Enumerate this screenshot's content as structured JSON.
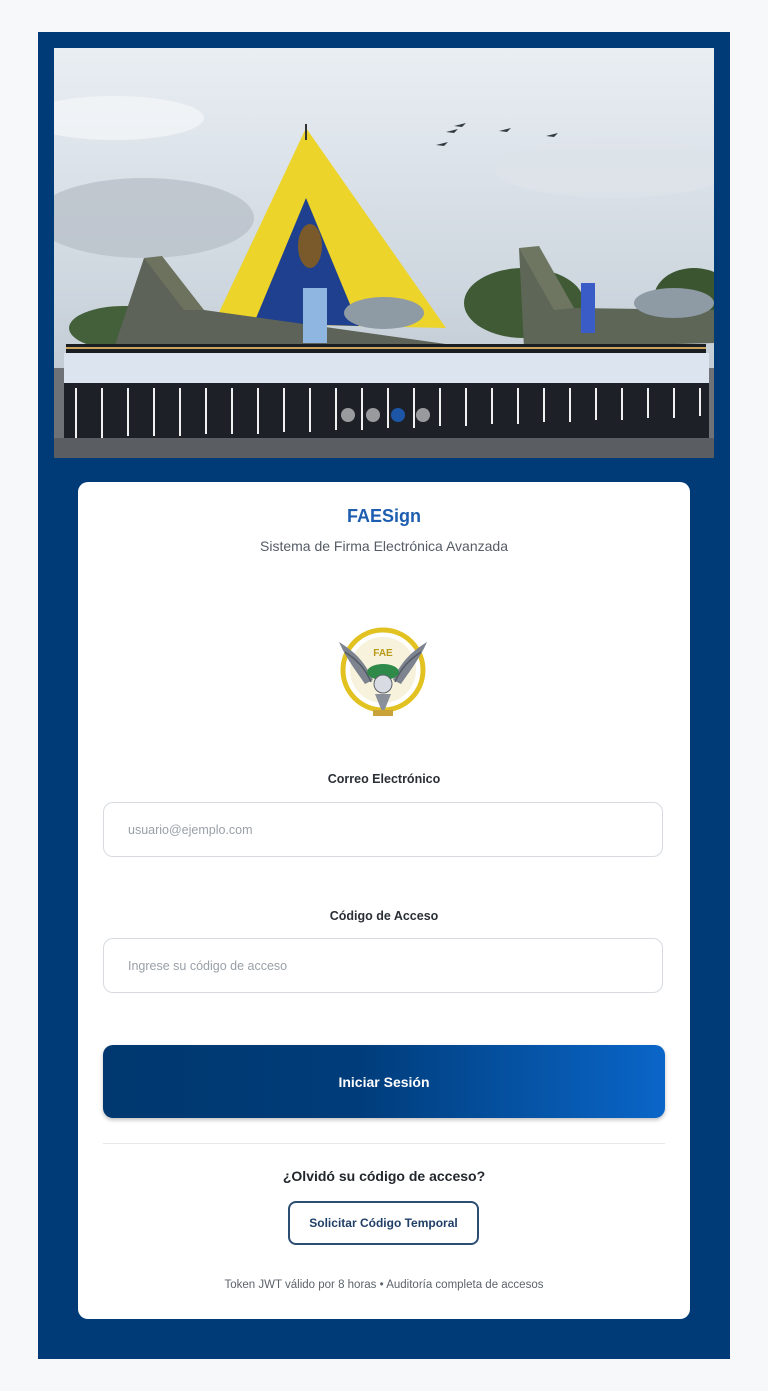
{
  "app": {
    "title": "FAESign",
    "subtitle": "Sistema de Firma Electrónica Avanzada"
  },
  "carousel": {
    "slide_count": 4,
    "active_index": 2
  },
  "form": {
    "email": {
      "label": "Correo Electrónico",
      "placeholder": "usuario@ejemplo.com",
      "value": ""
    },
    "code": {
      "label": "Código de Acceso",
      "placeholder": "Ingrese su código de acceso",
      "value": ""
    },
    "submit_label": "Iniciar Sesión"
  },
  "recovery": {
    "question": "¿Olvidó su código de acceso?",
    "button_label": "Solicitar Código Temporal"
  },
  "footer": {
    "note": "Token JWT válido por 8 horas • Auditoría completa de accesos"
  },
  "colors": {
    "frame_background": "#003b78",
    "accent": "#1d5eb0",
    "button_gradient_start": "#00386f",
    "button_gradient_end": "#0a66c8"
  }
}
